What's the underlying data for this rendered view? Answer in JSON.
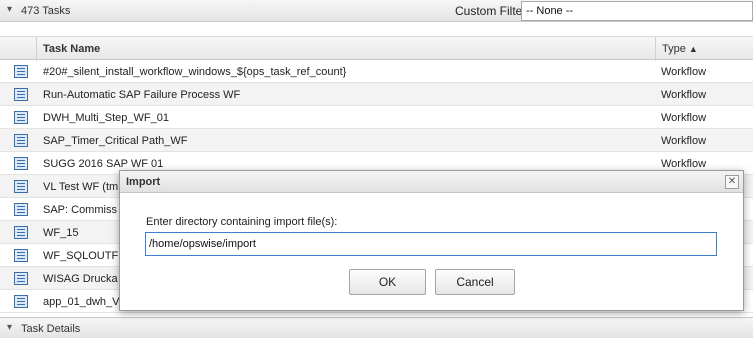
{
  "tasks_panel": {
    "chevron": "▾",
    "count_label": "473 Tasks",
    "filter_label": "Custom Filter",
    "filter_value": "-- None --"
  },
  "table": {
    "headers": {
      "task_name": "Task Name",
      "type": "Type",
      "sort_indicator": "▲"
    },
    "rows": [
      {
        "name": "#20#_silent_install_workflow_windows_${ops_task_ref_count}",
        "type": "Workflow"
      },
      {
        "name": "Run-Automatic SAP Failure Process WF",
        "type": "Workflow"
      },
      {
        "name": "DWH_Multi_Step_WF_01",
        "type": "Workflow"
      },
      {
        "name": "SAP_Timer_Critical Path_WF",
        "type": "Workflow"
      },
      {
        "name": "SUGG 2016 SAP WF 01",
        "type": "Workflow"
      },
      {
        "name": "VL Test WF (tm",
        "type": ""
      },
      {
        "name": "SAP: Commiss",
        "type": ""
      },
      {
        "name": "WF_15",
        "type": ""
      },
      {
        "name": "WF_SQLOUTF",
        "type": ""
      },
      {
        "name": "WISAG Drucka",
        "type": ""
      },
      {
        "name": "app_01_dwh_V",
        "type": ""
      }
    ]
  },
  "details_panel": {
    "chevron": "▾",
    "label": "Task Details"
  },
  "dialog": {
    "title": "Import",
    "close_glyph": "✕",
    "prompt": "Enter directory containing import file(s):",
    "directory_value": "/home/opswise/import",
    "ok_label": "OK",
    "cancel_label": "Cancel"
  },
  "icons": {
    "task": "workflow-task-icon"
  },
  "colors": {
    "accent": "#3c7fd1",
    "icon_blue": "#3a6ea5"
  }
}
